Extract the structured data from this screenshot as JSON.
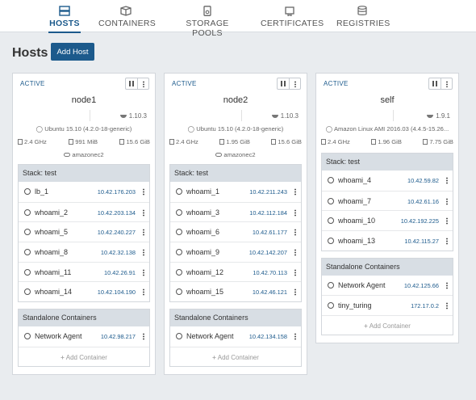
{
  "nav": {
    "items": [
      {
        "label": "HOSTS",
        "icon": "hosts-icon"
      },
      {
        "label": "CONTAINERS",
        "icon": "containers-icon"
      },
      {
        "label": "STORAGE POOLS",
        "icon": "storage-icon"
      },
      {
        "label": "CERTIFICATES",
        "icon": "certificates-icon"
      },
      {
        "label": "REGISTRIES",
        "icon": "registries-icon"
      }
    ]
  },
  "page": {
    "title": "Hosts",
    "add_host": "Add Host"
  },
  "colors": {
    "accent": "#1c5a8c",
    "group_header": "#d8dee4",
    "background": "#e9ecef"
  },
  "hosts": [
    {
      "state": "ACTIVE",
      "name": "node1",
      "docker_version": "1.10.3",
      "os": "Ubuntu 15.10 (4.2.0-18-generic)",
      "cpu": "2.4 GHz",
      "memory": "991 MiB",
      "disk": "15.6 GiB",
      "driver": "amazonec2",
      "stack_label": "Stack: test",
      "containers": [
        {
          "name": "lb_1",
          "ip": "10.42.176.203"
        },
        {
          "name": "whoami_2",
          "ip": "10.42.203.134"
        },
        {
          "name": "whoami_5",
          "ip": "10.42.240.227"
        },
        {
          "name": "whoami_8",
          "ip": "10.42.32.138"
        },
        {
          "name": "whoami_11",
          "ip": "10.42.26.91"
        },
        {
          "name": "whoami_14",
          "ip": "10.42.104.190"
        }
      ],
      "standalone_label": "Standalone Containers",
      "standalone": [
        {
          "name": "Network Agent",
          "ip": "10.42.98.217"
        }
      ],
      "add_container": "Add Container"
    },
    {
      "state": "ACTIVE",
      "name": "node2",
      "docker_version": "1.10.3",
      "os": "Ubuntu 15.10 (4.2.0-18-generic)",
      "cpu": "2.4 GHz",
      "memory": "1.95 GiB",
      "disk": "15.6 GiB",
      "driver": "amazonec2",
      "stack_label": "Stack: test",
      "containers": [
        {
          "name": "whoami_1",
          "ip": "10.42.211.243"
        },
        {
          "name": "whoami_3",
          "ip": "10.42.112.184"
        },
        {
          "name": "whoami_6",
          "ip": "10.42.61.177"
        },
        {
          "name": "whoami_9",
          "ip": "10.42.142.207"
        },
        {
          "name": "whoami_12",
          "ip": "10.42.70.113"
        },
        {
          "name": "whoami_15",
          "ip": "10.42.46.121"
        }
      ],
      "standalone_label": "Standalone Containers",
      "standalone": [
        {
          "name": "Network Agent",
          "ip": "10.42.134.158"
        }
      ],
      "add_container": "Add Container"
    },
    {
      "state": "ACTIVE",
      "name": "self",
      "docker_version": "1.9.1",
      "os": "Amazon Linux AMI 2016.03 (4.4.5-15.26...",
      "cpu": "2.4 GHz",
      "memory": "1.96 GiB",
      "disk": "7.75 GiB",
      "driver": "",
      "stack_label": "Stack: test",
      "containers": [
        {
          "name": "whoami_4",
          "ip": "10.42.59.82"
        },
        {
          "name": "whoami_7",
          "ip": "10.42.61.16"
        },
        {
          "name": "whoami_10",
          "ip": "10.42.192.225"
        },
        {
          "name": "whoami_13",
          "ip": "10.42.115.27"
        }
      ],
      "standalone_label": "Standalone Containers",
      "standalone": [
        {
          "name": "Network Agent",
          "ip": "10.42.125.66"
        },
        {
          "name": "tiny_turing",
          "ip": "172.17.0.2"
        }
      ],
      "add_container": "Add Container"
    }
  ]
}
